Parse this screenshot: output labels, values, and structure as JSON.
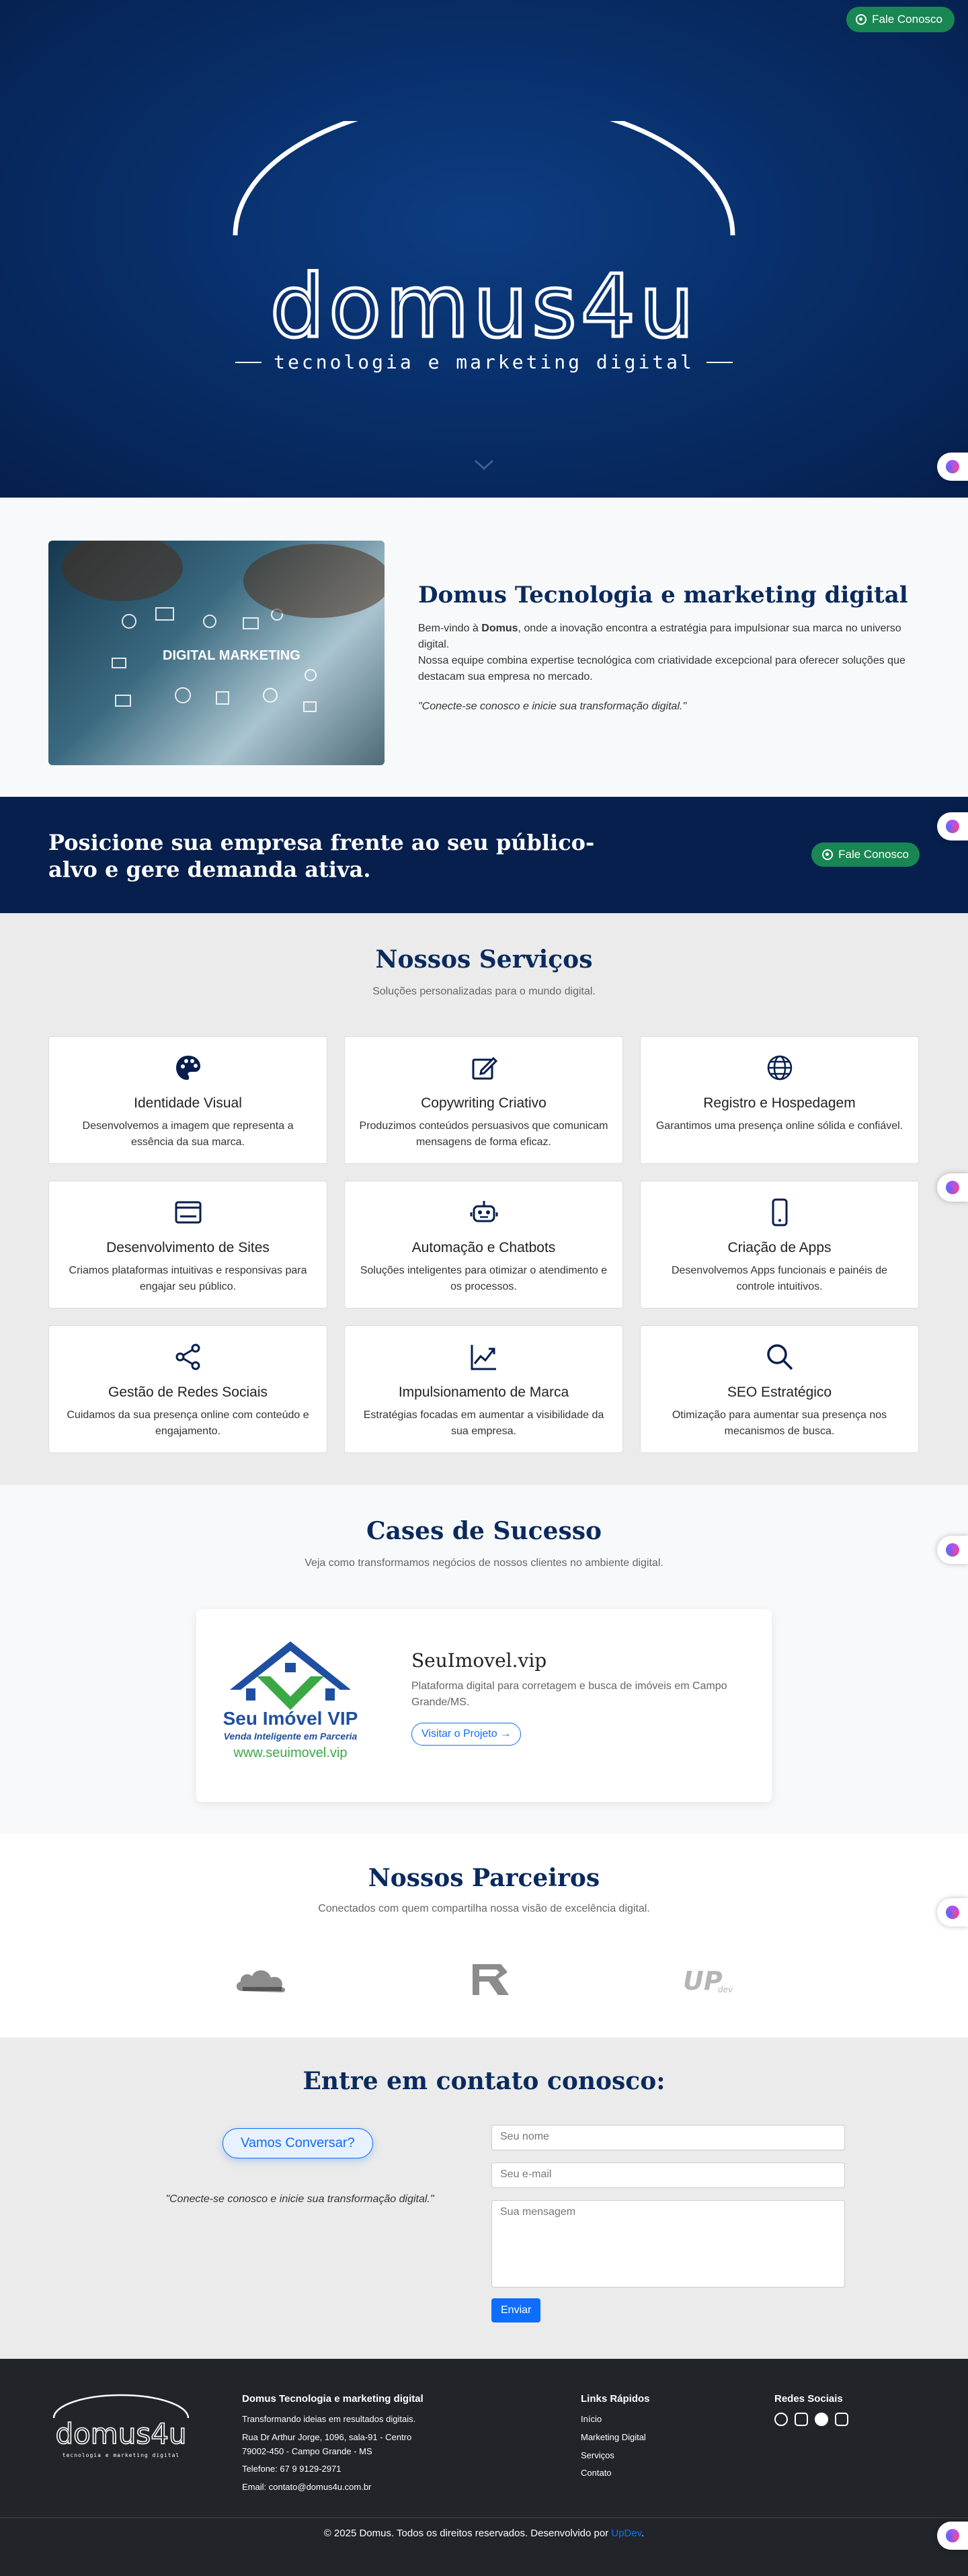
{
  "hero": {
    "cta_label": "Fale Conosco",
    "logo_text": "domus4u",
    "tagline": "tecnologia e marketing digital"
  },
  "about": {
    "image_text": "DIGITAL MARKETING",
    "title": "Domus Tecnologia e marketing digital",
    "p1_prefix": "Bem-vindo à ",
    "p1_brand": "Domus",
    "p1_suffix": ", onde a inovação encontra a estratégia para impulsionar sua marca no universo digital.",
    "p2": "Nossa equipe combina expertise tecnológica com criatividade excepcional para oferecer soluções que destacam sua empresa no mercado.",
    "quote": "\"Conecte-se conosco e inicie sua transformação digital.\""
  },
  "banner": {
    "title": "Posicione sua empresa frente ao seu público-alvo e gere demanda ativa.",
    "cta_label": "Fale Conosco"
  },
  "services": {
    "title": "Nossos Serviços",
    "subtitle": "Soluções personalizadas para o mundo digital.",
    "items": [
      {
        "icon": "palette-icon",
        "title": "Identidade Visual",
        "desc": "Desenvolvemos a imagem que representa a essência da sua marca."
      },
      {
        "icon": "pencil-square-icon",
        "title": "Copywriting Criativo",
        "desc": "Produzimos conteúdos persuasivos que comunicam mensagens de forma eficaz."
      },
      {
        "icon": "globe-icon",
        "title": "Registro e Hospedagem",
        "desc": "Garantimos uma presença online sólida e confiável."
      },
      {
        "icon": "browser-window-icon",
        "title": "Desenvolvimento de Sites",
        "desc": "Criamos plataformas intuitivas e responsivas para engajar seu público."
      },
      {
        "icon": "robot-icon",
        "title": "Automação e Chatbots",
        "desc": "Soluções inteligentes para otimizar o atendimento e os processos."
      },
      {
        "icon": "phone-icon",
        "title": "Criação de Apps",
        "desc": "Desenvolvemos Apps funcionais e painéis de controle intuitivos."
      },
      {
        "icon": "share-icon",
        "title": "Gestão de Redes Sociais",
        "desc": "Cuidamos da sua presença online com conteúdo e engajamento."
      },
      {
        "icon": "graph-up-icon",
        "title": "Impulsionamento de Marca",
        "desc": "Estratégias focadas em aumentar a visibilidade da sua empresa."
      },
      {
        "icon": "search-icon",
        "title": "SEO Estratégico",
        "desc": "Otimização para aumentar sua presença nos mecanismos de busca."
      }
    ]
  },
  "cases": {
    "title": "Cases de Sucesso",
    "subtitle": "Veja como transformamos negócios de nossos clientes no ambiente digital.",
    "item": {
      "logo_line1": "Seu Imóvel VIP",
      "logo_line2": "Venda Inteligente em Parceria",
      "logo_line3": "www.seuimovel.vip",
      "title": "SeuImovel.vip",
      "desc": "Plataforma digital para corretagem e busca de imóveis em Campo Grande/MS.",
      "cta_label": "Visitar o Projeto →"
    }
  },
  "partners": {
    "title": "Nossos Parceiros",
    "subtitle": "Conectados com quem compartilha nossa visão de excelência digital.",
    "logos": [
      "cloud-partner-logo",
      "r-partner-logo",
      "up-partner-logo"
    ]
  },
  "contact": {
    "title": "Entre em contato conosco:",
    "pill_label": "Vamos Conversar?",
    "quote": "\"Conecte-se conosco e inicie sua transformação digital.\"",
    "name_placeholder": "Seu nome",
    "email_placeholder": "Seu e-mail",
    "message_placeholder": "Sua mensagem",
    "submit_label": "Enviar"
  },
  "footer": {
    "logo_text": "domus4u",
    "logo_tagline": "tecnologia e marketing digital",
    "company_title": "Domus Tecnologia e marketing digital",
    "company_slogan": "Transformando ideias em resultados digitais.",
    "address1": "Rua Dr Arthur Jorge, 1096, sala-91 - Centro",
    "address2": "79002-450 - Campo Grande - MS",
    "phone": "Telefone: 67 9 9129-2971",
    "email": "Email: contato@domus4u.com.br",
    "links_title": "Links Rápidos",
    "links": [
      "Início",
      "Marketing Digital",
      "Serviços",
      "Contato"
    ],
    "social_title": "Redes Sociais",
    "social_icons": [
      "whatsapp-icon",
      "instagram-icon",
      "facebook-icon",
      "linkedin-icon"
    ],
    "copyright": "© 2025 Domus. Todos os direitos reservados. Desenvolvido por ",
    "dev_link": "UpDev",
    "copyright_end": "."
  },
  "colors": {
    "navy": "#061f4c",
    "whatsapp_green": "#198754",
    "primary_blue": "#0d6efd",
    "footer_dark": "#212529"
  }
}
